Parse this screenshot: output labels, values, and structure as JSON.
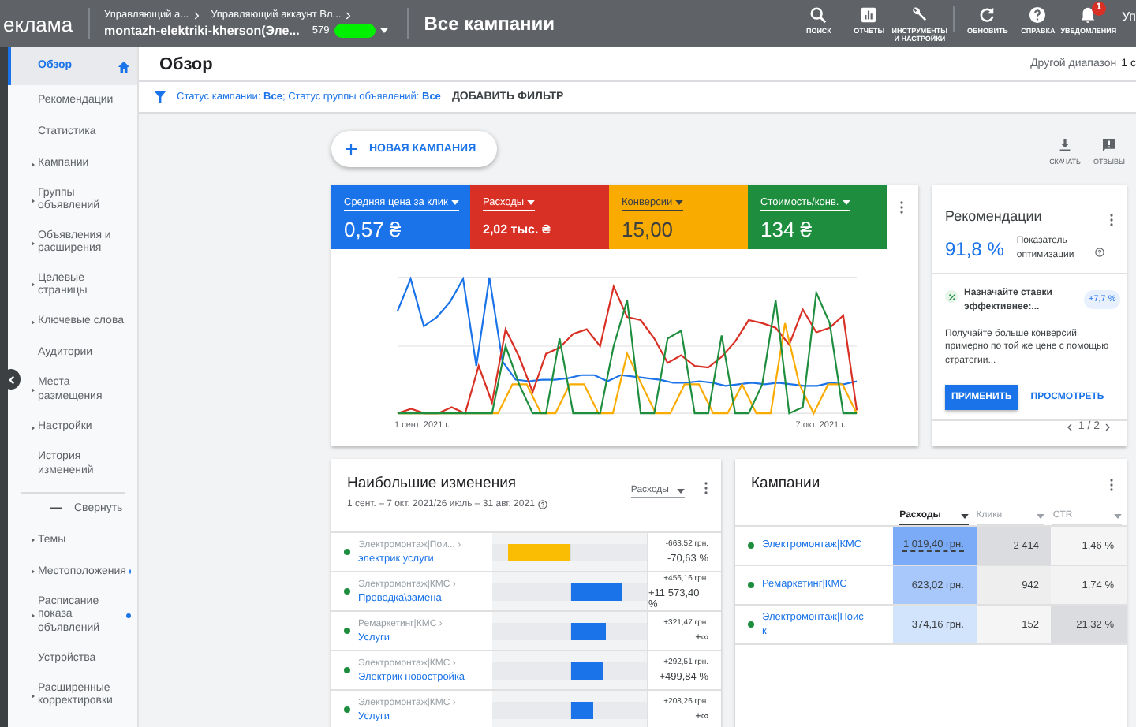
{
  "top_bar": {
    "app_title": "еклама",
    "breadcrumbs": [
      "Управляющий а...",
      "Управляющий аккаунт Вл..."
    ],
    "account_name": "montazh-elektriki-kherson(Эле...",
    "account_id": "579",
    "page_title": "Все кампании",
    "actions": [
      {
        "kind": "search",
        "label": "ПОИСК"
      },
      {
        "kind": "reports",
        "label": "ОТЧЕТЫ"
      },
      {
        "kind": "tools",
        "label": "ИНСТРУМЕНТЫ И НАСТРОЙКИ"
      },
      {
        "kind": "refresh",
        "label": "ОБНОВИТЬ"
      },
      {
        "kind": "help",
        "label": "СПРАВКА"
      },
      {
        "kind": "notifications",
        "label": "УВЕДОМЛЕНИЯ",
        "badge": "1"
      }
    ],
    "cut_text": "Уп"
  },
  "sidebar": {
    "items": [
      {
        "label": "Обзор",
        "kind": "plain",
        "selected": true,
        "expandable": false,
        "dot": false
      },
      {
        "label": "Рекомендации",
        "kind": "plain",
        "selected": false,
        "expandable": false,
        "dot": false
      },
      {
        "label": "Статистика",
        "kind": "plain",
        "selected": false,
        "expandable": false,
        "dot": false
      },
      {
        "label": "Кампании",
        "kind": "plain",
        "selected": false,
        "expandable": true,
        "dot": false
      },
      {
        "label": "Группы объявлений",
        "kind": "plain",
        "selected": false,
        "expandable": true,
        "dot": false
      },
      {
        "label": "Объявления и расширения",
        "kind": "plain",
        "selected": false,
        "expandable": true,
        "dot": false
      },
      {
        "label": "Целевые страницы",
        "kind": "plain",
        "selected": false,
        "expandable": true,
        "dot": false
      },
      {
        "label": "Ключевые слова",
        "kind": "plain",
        "selected": false,
        "expandable": true,
        "dot": false
      },
      {
        "label": "Аудитории",
        "kind": "plain",
        "selected": false,
        "expandable": false,
        "dot": false
      },
      {
        "label": "Места размещения",
        "kind": "plain",
        "selected": false,
        "expandable": true,
        "dot": false
      },
      {
        "label": "Настройки",
        "kind": "plain",
        "selected": false,
        "expandable": true,
        "dot": false
      },
      {
        "label": "История изменений",
        "kind": "plain",
        "selected": false,
        "expandable": false,
        "dot": false
      },
      {
        "label": "Свернуть",
        "kind": "collapse",
        "icon": "—",
        "selected": false,
        "expandable": false,
        "dot": false
      },
      {
        "label": "Темы",
        "kind": "plain",
        "selected": false,
        "expandable": true,
        "dot": false
      },
      {
        "label": "Местоположения",
        "kind": "plain",
        "selected": false,
        "expandable": true,
        "dot": true
      },
      {
        "label": "Расписание показа объявлений",
        "kind": "plain",
        "selected": false,
        "expandable": true,
        "dot": true
      },
      {
        "label": "Устройства",
        "kind": "plain",
        "selected": false,
        "expandable": false,
        "dot": false
      },
      {
        "label": "Расширенные корректировки",
        "kind": "plain",
        "selected": false,
        "expandable": true,
        "dot": false
      }
    ]
  },
  "page_header": {
    "title": "Обзор",
    "date_range_label": "Другой диапазон",
    "date_cut": "1 с"
  },
  "filter_bar": {
    "text": "Статус кампании: **Все**; Статус группы объявлений: **Все**",
    "add_filter": "ДОБАВИТЬ ФИЛЬТР"
  },
  "toolbar": {
    "new_campaign": "НОВАЯ КАМПАНИЯ",
    "actions": [
      {
        "kind": "download",
        "label": "СКАЧАТЬ"
      },
      {
        "kind": "feedback",
        "label": "ОТЗЫВЫ"
      }
    ]
  },
  "performance": {
    "metrics": [
      {
        "label": "Средняя цена за клик",
        "value": "0,57 ₴",
        "color": "#1a73e8",
        "kind": "large"
      },
      {
        "label": "Расходы",
        "value": "2,02 тыс. ₴",
        "color": "#d93025",
        "kind": "compact"
      },
      {
        "label": "Конверсии",
        "value": "15,00",
        "color": "#f9ab00",
        "kind": "large"
      },
      {
        "label": "Стоимость/конв.",
        "value": "134 ₴",
        "color": "#1e8e3e",
        "kind": "large"
      }
    ],
    "x_start": "1 сент. 2021 г.",
    "x_end": "7 окт. 2021 г."
  },
  "recommendations": {
    "title": "Рекомендации",
    "score": "91,8 %",
    "score_label": "Показатель оптимизации",
    "item_title": "Назначайте ставки эффективнее:...",
    "item_badge": "+7,7 %",
    "item_text": "Получайте больше конверсий примерно по той же цене с помощью стратегии...",
    "apply": "ПРИМЕНИТЬ",
    "view": "ПРОСМОТРЕТЬ",
    "pager": "1 / 2"
  },
  "changes": {
    "title": "Наибольшие изменения",
    "subtitle": "1 сент. – 7 окт. 2021/26 июль – 31 авг. 2021",
    "metric": "Расходы",
    "rows": [
      {
        "campaign": "Электромонтаж|Пои... ›",
        "group": "электрик услуги",
        "amount": "-663,52 грн.",
        "percent": "-70,63 %",
        "kind": "decrease",
        "level": 0.8,
        "color": "#1e8e3e"
      },
      {
        "campaign": "Электромонтаж|КМС ›",
        "group": "Проводка\\замена",
        "amount": "+456,16 грн.",
        "percent": "+11 573,40 %",
        "kind": "increase",
        "level": 0.66,
        "color": "#1e8e3e"
      },
      {
        "campaign": "Ремаркетинг|КМС ›",
        "group": "Услуги",
        "amount": "+321,47 грн.",
        "percent": "+∞",
        "kind": "increase",
        "level": 0.46,
        "color": "#1e8e3e"
      },
      {
        "campaign": "Электромонтаж|КМС ›",
        "group": "Электрик новостройка",
        "amount": "+292,51 грн.",
        "percent": "+499,84 %",
        "kind": "increase",
        "level": 0.42,
        "color": "#1e8e3e"
      },
      {
        "campaign": "Электромонтаж|КМС ›",
        "group": "Услуги",
        "amount": "+208,26 грн.",
        "percent": "+∞",
        "kind": "increase",
        "level": 0.29,
        "color": "#1e8e3e"
      }
    ]
  },
  "campaigns": {
    "title": "Кампании",
    "columns": [
      {
        "label": "Расходы",
        "sorted": true
      },
      {
        "label": "Клики",
        "sorted": false
      },
      {
        "label": "CTR",
        "sorted": false
      }
    ],
    "rows": [
      {
        "name": "Электромонтаж|КМС",
        "color": "#1e8e3e",
        "cells": [
          {
            "text": "1 019,40 грн.",
            "color": "#7baaf7"
          },
          {
            "text": "2 414",
            "color": "#dadce0"
          },
          {
            "text": "1,46 %",
            "color": "#f5f5f5"
          }
        ]
      },
      {
        "name": "Ремаркетинг|КМС",
        "color": "#1e8e3e",
        "cells": [
          {
            "text": "623,02 грн.",
            "color": "#a8c7fa"
          },
          {
            "text": "942",
            "color": "#eeeeee"
          },
          {
            "text": "1,74 %",
            "color": "#f3f3f3"
          }
        ]
      },
      {
        "name": "Электромонтаж|Поиск",
        "color": "#1e8e3e",
        "cells": [
          {
            "text": "374,16 грн.",
            "color": "#d2e3fc"
          },
          {
            "text": "152",
            "color": "#f5f5f5"
          },
          {
            "text": "21,32 %",
            "color": "#dadce0"
          }
        ]
      }
    ]
  }
}
